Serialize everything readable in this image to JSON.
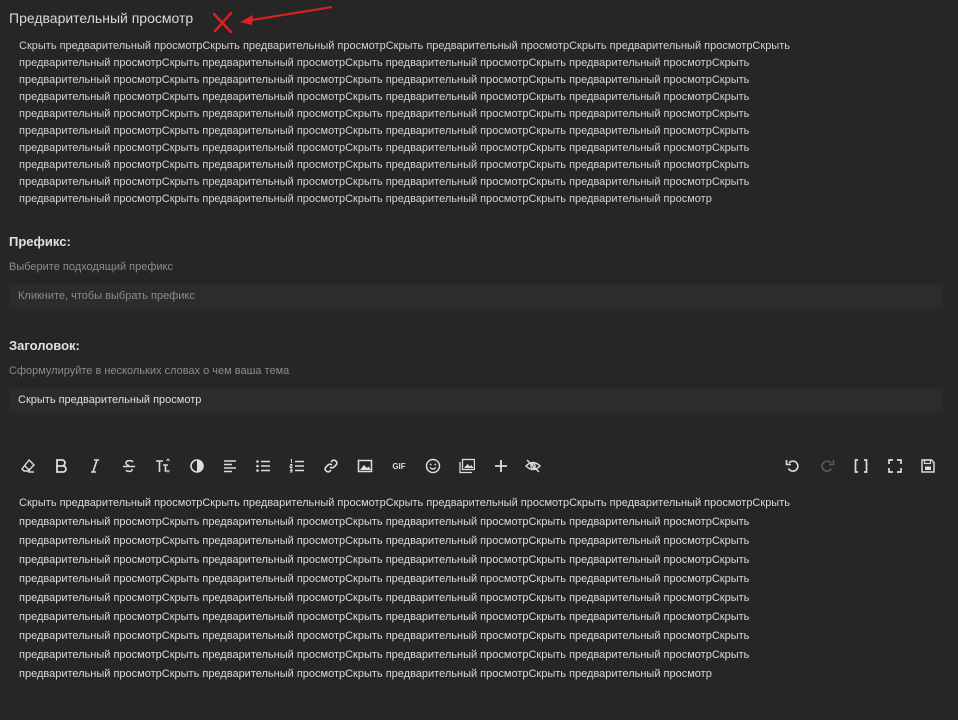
{
  "preview": {
    "title": "Предварительный просмотр",
    "text": "Скрыть предварительный просмотрСкрыть предварительный просмотрСкрыть предварительный просмотрСкрыть предварительный просмотрСкрыть\nпредварительный просмотрСкрыть предварительный просмотрСкрыть предварительный просмотрСкрыть предварительный просмотрСкрыть\nпредварительный просмотрСкрыть предварительный просмотрСкрыть предварительный просмотрСкрыть предварительный просмотрСкрыть\nпредварительный просмотрСкрыть предварительный просмотрСкрыть предварительный просмотрСкрыть предварительный просмотрСкрыть\nпредварительный просмотрСкрыть предварительный просмотрСкрыть предварительный просмотрСкрыть предварительный просмотрСкрыть\nпредварительный просмотрСкрыть предварительный просмотрСкрыть предварительный просмотрСкрыть предварительный просмотрСкрыть\nпредварительный просмотрСкрыть предварительный просмотрСкрыть предварительный просмотрСкрыть предварительный просмотрСкрыть\nпредварительный просмотрСкрыть предварительный просмотрСкрыть предварительный просмотрСкрыть предварительный просмотрСкрыть\nпредварительный просмотрСкрыть предварительный просмотрСкрыть предварительный просмотрСкрыть предварительный просмотрСкрыть\nпредварительный просмотрСкрыть предварительный просмотрСкрыть предварительный просмотрСкрыть предварительный просмотр"
  },
  "prefix": {
    "label": "Префикс:",
    "hint": "Выберите подходящий префикс",
    "placeholder": "Кликните, чтобы выбрать префикс"
  },
  "title_field": {
    "label": "Заголовок:",
    "hint": "Сформулируйте в нескольких словах о чем ваша тема",
    "value": "Скрыть предварительный просмотр"
  },
  "toolbar": {
    "left_icons": [
      "eraser-icon",
      "bold-icon",
      "italic-icon",
      "strikethrough-icon",
      "text-size-icon",
      "color-icon",
      "align-icon",
      "bullet-list-icon",
      "numbered-list-icon",
      "link-icon",
      "image-icon",
      "gif-icon",
      "emoji-icon",
      "gallery-icon",
      "plus-icon",
      "hide-preview-icon"
    ],
    "right_icons": [
      "undo-icon",
      "redo-icon",
      "code-brackets-icon",
      "fullscreen-icon",
      "save-icon"
    ],
    "gif_label": "GIF"
  },
  "editor": {
    "text": "Скрыть предварительный просмотрСкрыть предварительный просмотрСкрыть предварительный просмотрСкрыть предварительный просмотрСкрыть\nпредварительный просмотрСкрыть предварительный просмотрСкрыть предварительный просмотрСкрыть предварительный просмотрСкрыть\nпредварительный просмотрСкрыть предварительный просмотрСкрыть предварительный просмотрСкрыть предварительный просмотрСкрыть\nпредварительный просмотрСкрыть предварительный просмотрСкрыть предварительный просмотрСкрыть предварительный просмотрСкрыть\nпредварительный просмотрСкрыть предварительный просмотрСкрыть предварительный просмотрСкрыть предварительный просмотрСкрыть\nпредварительный просмотрСкрыть предварительный просмотрСкрыть предварительный просмотрСкрыть предварительный просмотрСкрыть\nпредварительный просмотрСкрыть предварительный просмотрСкрыть предварительный просмотрСкрыть предварительный просмотрСкрыть\nпредварительный просмотрСкрыть предварительный просмотрСкрыть предварительный просмотрСкрыть предварительный просмотрСкрыть\nпредварительный просмотрСкрыть предварительный просмотрСкрыть предварительный просмотрСкрыть предварительный просмотрСкрыть\nпредварительный просмотрСкрыть предварительный просмотрСкрыть предварительный просмотрСкрыть предварительный просмотр"
  },
  "colors": {
    "background": "#262626",
    "field_background": "#2c2c2c",
    "annotation_red": "#e02020"
  }
}
